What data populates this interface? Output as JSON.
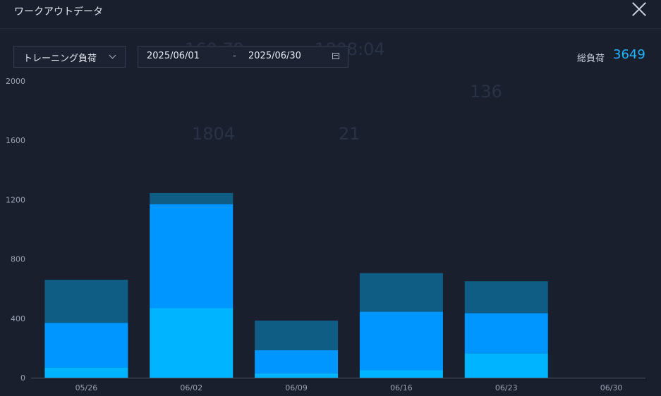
{
  "window": {
    "title": "ワークアウトデータ"
  },
  "controls": {
    "metric_select": "トレーニング負荷",
    "date_start": "2025/06/01",
    "date_separator": "-",
    "date_end": "2025/06/30"
  },
  "summary": {
    "total_label": "総負荷",
    "total_value": "3649"
  },
  "background_ghost_numbers": [
    "160.79",
    "1808:04",
    "136",
    "1804",
    "21"
  ],
  "colors": {
    "background": "#1a1f2e",
    "accent": "#1fb6ff",
    "series_light": "#00b4ff",
    "series_mid": "#0096ff",
    "series_dark": "#0f5c85"
  },
  "chart_data": {
    "type": "bar",
    "stacked": true,
    "categories": [
      "05/26",
      "06/02",
      "06/09",
      "06/16",
      "06/23",
      "06/30"
    ],
    "series": [
      {
        "values": [
          70,
          470,
          30,
          50,
          165,
          0
        ],
        "color": "#00b4ff"
      },
      {
        "values": [
          300,
          700,
          155,
          395,
          270,
          0
        ],
        "color": "#0096ff"
      },
      {
        "values": [
          290,
          75,
          200,
          260,
          215,
          0
        ],
        "color": "#0f5c85"
      }
    ],
    "yticks": [
      "0",
      "400",
      "800",
      "1200",
      "1600",
      "2000"
    ],
    "ylim": [
      0,
      2000
    ],
    "grid": false
  }
}
